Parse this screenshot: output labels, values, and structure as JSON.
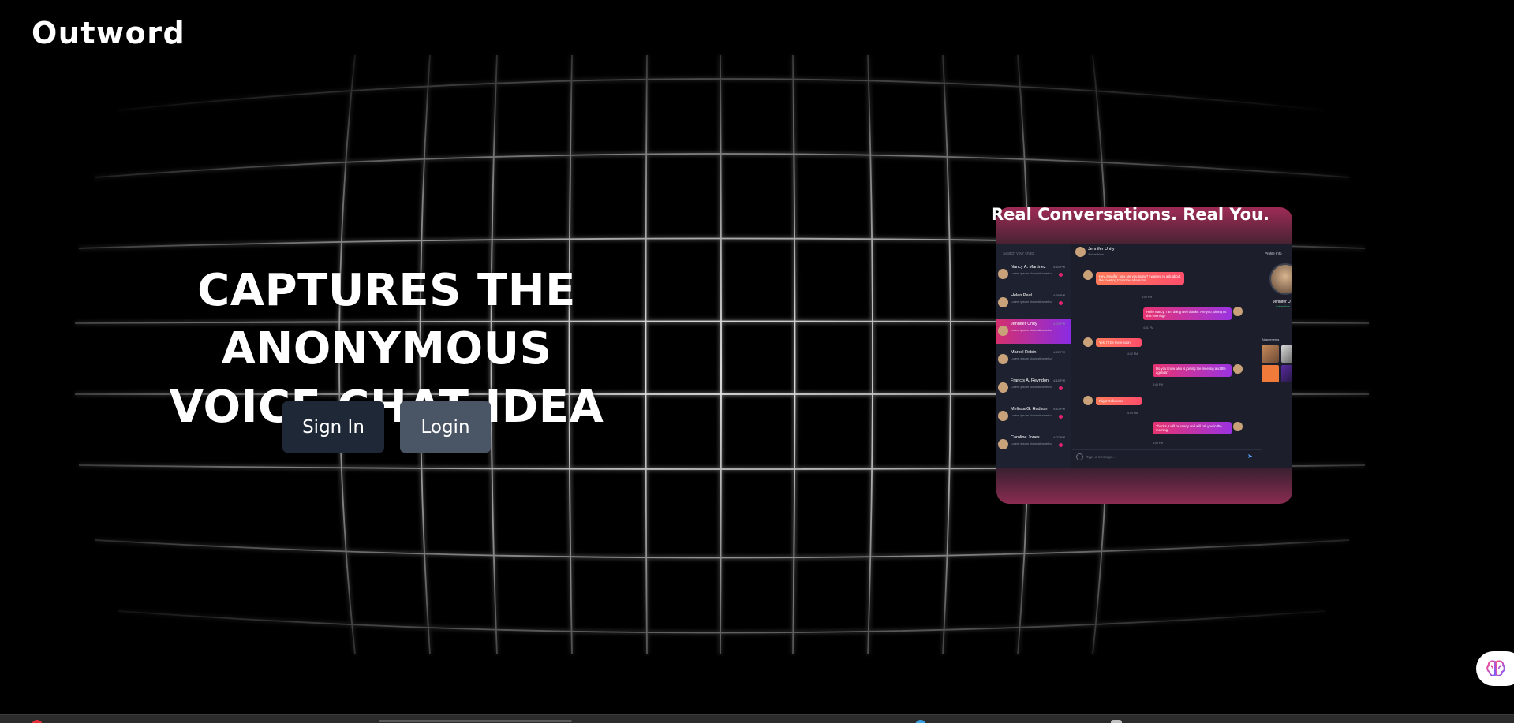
{
  "header": {
    "brand": "Outword"
  },
  "hero": {
    "headline_line1": "CAPTURES THE ANONYMOUS",
    "headline_line2": "VOICE CHAT IDEA"
  },
  "actions": {
    "signin_label": "Sign In",
    "login_label": "Login"
  },
  "showcase": {
    "title": "Real Conversations. Real You.",
    "app": {
      "search_placeholder": "Search your chats",
      "chats": [
        {
          "name": "Nancy A. Martinez",
          "preview": "Lorem ipsum dolor sit amet consectetur",
          "time": "4:44 PM",
          "unread": true
        },
        {
          "name": "Helen Paul",
          "preview": "Lorem ipsum dolor sit amet consectetur",
          "time": "4:38 PM",
          "unread": true
        },
        {
          "name": "Jennifer Unity",
          "preview": "Lorem ipsum dolor sit amet consectetur",
          "time": "4:26 PM",
          "unread": false,
          "active": true
        },
        {
          "name": "Marcel Robin",
          "preview": "Lorem ipsum dolor sit amet consectetur",
          "time": "4:22 PM",
          "unread": false
        },
        {
          "name": "Francis A. Reyndon",
          "preview": "Lorem ipsum dolor sit amet consectetur",
          "time": "4:18 PM",
          "unread": true
        },
        {
          "name": "Melissa G. Hudson",
          "preview": "Lorem ipsum dolor sit amet consectetur",
          "time": "4:10 PM",
          "unread": true
        },
        {
          "name": "Caroline Jones",
          "preview": "Lorem ipsum dolor sit amet consectetur",
          "time": "4:02 PM",
          "unread": true
        }
      ],
      "conversation": {
        "name": "Jennifer Unity",
        "status": "Active Now",
        "messages": [
          {
            "dir": "in",
            "text": "Hey Jennifer, how are you today? I wanted to ask about the meeting tomorrow afternoon.",
            "time": "4:40 PM"
          },
          {
            "dir": "out",
            "text": "Hello Nancy, I am doing well thanks. Are you joining us this evening?",
            "time": "4:41 PM"
          },
          {
            "dir": "in",
            "text": "Yes, I'll be there soon",
            "time": "4:42 PM"
          },
          {
            "dir": "out",
            "text": "Do you know who is joining the meeting and the agenda?",
            "time": "4:43 PM"
          },
          {
            "dir": "in",
            "text": "Flight Reference",
            "time": "4:44 PM"
          },
          {
            "dir": "out",
            "text": "Thanks, I will be ready and will call you in the morning.",
            "time": "4:45 PM"
          }
        ],
        "compose_placeholder": "Type a message..."
      },
      "profile": {
        "label": "Profile Info",
        "name": "Jennifer U",
        "status": "Active Now",
        "attachments_label": "Attachments"
      }
    }
  },
  "colors": {
    "background": "#000000",
    "btn_signin": "#1f2836",
    "btn_login": "#4a5566",
    "accent_pink": "#e8336f",
    "accent_purple": "#9b33e0"
  }
}
